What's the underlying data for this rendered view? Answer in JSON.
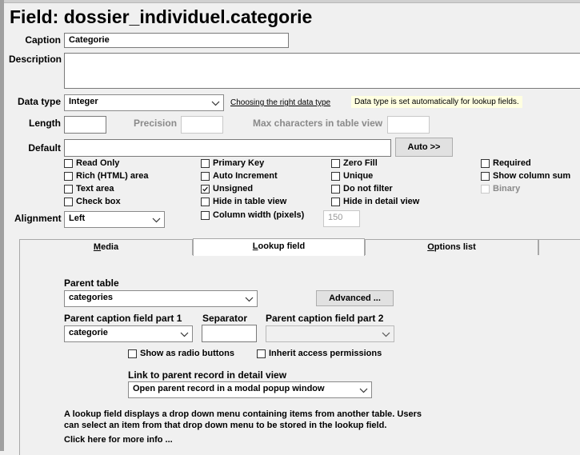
{
  "title": "Field: dossier_individuel.categorie",
  "caption": {
    "label": "Caption",
    "value": "Categorie"
  },
  "description": {
    "label": "Description",
    "value": ""
  },
  "datatype": {
    "label": "Data type",
    "value": "Integer",
    "help_link": "Choosing the right data type",
    "hint": "Data type is set automatically for lookup fields."
  },
  "length": {
    "label": "Length",
    "value": ""
  },
  "precision": {
    "label": "Precision",
    "value": ""
  },
  "maxchars": {
    "label": "Max characters in table view",
    "value": ""
  },
  "default": {
    "label": "Default",
    "value": "",
    "auto_button": "Auto >>"
  },
  "checkboxes": {
    "read_only": {
      "label": "Read Only",
      "checked": false
    },
    "rich_html": {
      "label": "Rich (HTML) area",
      "checked": false
    },
    "text_area": {
      "label": "Text area",
      "checked": false
    },
    "check_box": {
      "label": "Check box",
      "checked": false
    },
    "primary_key": {
      "label": "Primary Key",
      "checked": false
    },
    "auto_increment": {
      "label": "Auto Increment",
      "checked": false
    },
    "unsigned": {
      "label": "Unsigned",
      "checked": true
    },
    "hide_in_table_view": {
      "label": "Hide in table view",
      "checked": false
    },
    "column_width": {
      "label": "Column width (pixels)",
      "checked": false,
      "value": "150"
    },
    "zero_fill": {
      "label": "Zero Fill",
      "checked": false
    },
    "unique": {
      "label": "Unique",
      "checked": false
    },
    "do_not_filter": {
      "label": "Do not filter",
      "checked": false
    },
    "hide_in_detail_view": {
      "label": "Hide in detail view",
      "checked": false
    },
    "required": {
      "label": "Required",
      "checked": false
    },
    "show_column_sum": {
      "label": "Show column sum",
      "checked": false
    },
    "binary": {
      "label": "Binary",
      "checked": false
    }
  },
  "alignment": {
    "label": "Alignment",
    "value": "Left"
  },
  "tabs": [
    {
      "label": "Media",
      "underline": "M",
      "rest": "edia"
    },
    {
      "label": "Lookup field",
      "underline": "L",
      "rest": "ookup field"
    },
    {
      "label": "Options list",
      "underline": "O",
      "rest": "ptions list"
    }
  ],
  "lookup": {
    "parent_table": {
      "label": "Parent table",
      "value": "categories"
    },
    "advanced_button": "Advanced ...",
    "caption_part1": {
      "label": "Parent caption field part 1",
      "value": "categorie"
    },
    "separator": {
      "label": "Separator",
      "value": ""
    },
    "caption_part2": {
      "label": "Parent caption field part 2",
      "value": ""
    },
    "show_as_radio": {
      "label": "Show as radio buttons",
      "checked": false
    },
    "inherit_access": {
      "label": "Inherit access permissions",
      "checked": false
    },
    "link_to_parent": {
      "label": "Link to parent record in detail view",
      "value": "Open parent record in a modal popup window"
    },
    "info_line1": "A lookup field displays a drop down menu containing items from another table. Users",
    "info_line2": "can select an item from that drop down menu to be stored in the lookup field.",
    "more_info": "Click here for more info ..."
  },
  "icons": {
    "dropdown": "chevron-down-icon",
    "checkmark": "checkmark-icon"
  }
}
